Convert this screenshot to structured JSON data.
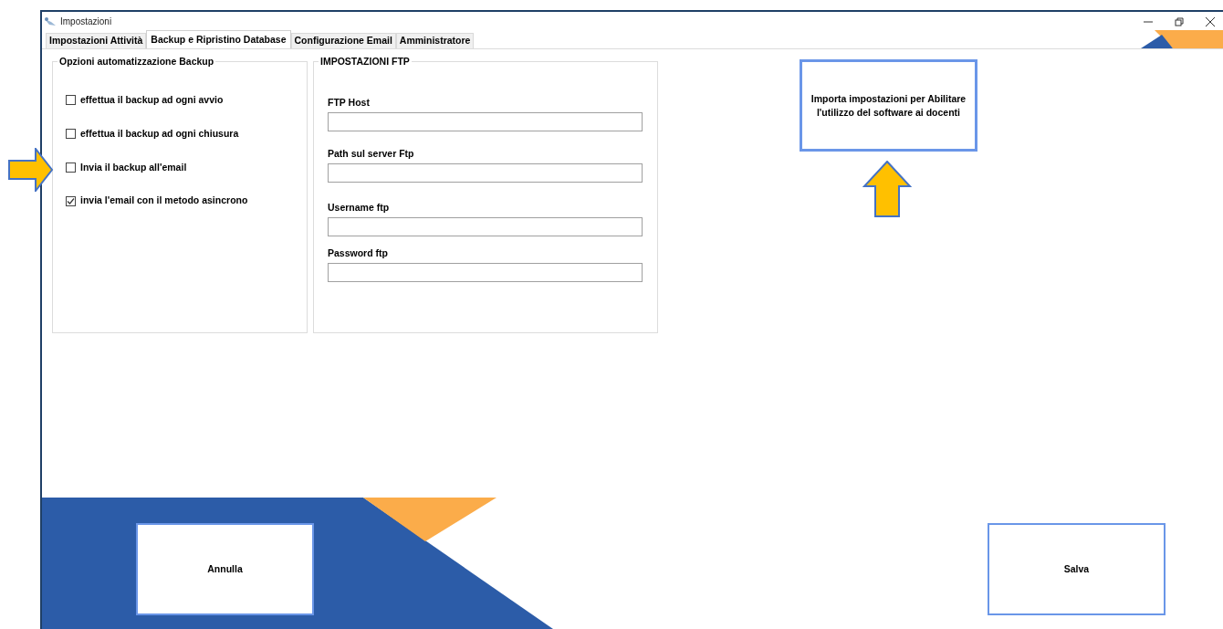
{
  "window": {
    "title": "Impostazioni"
  },
  "tabs": [
    {
      "label": "Impostazioni Attività",
      "selected": false
    },
    {
      "label": "Backup e Ripristino Database",
      "selected": true
    },
    {
      "label": "Configurazione Email",
      "selected": false
    },
    {
      "label": "Amministratore",
      "selected": false
    }
  ],
  "backup_options": {
    "title": "Opzioni automatizzazione Backup",
    "items": [
      {
        "label": "effettua il backup ad ogni avvio",
        "checked": false
      },
      {
        "label": "effettua il backup ad ogni chiusura",
        "checked": false
      },
      {
        "label": "Invia il backup all'email",
        "checked": false
      },
      {
        "label": "invia l'email con il metodo asincrono",
        "checked": true
      }
    ]
  },
  "ftp_settings": {
    "title": "IMPOSTAZIONI FTP",
    "fields": [
      {
        "label": "FTP Host"
      },
      {
        "label": "Path sul server Ftp"
      },
      {
        "label": "Username ftp"
      },
      {
        "label": "Password ftp"
      }
    ]
  },
  "import_button": {
    "label": "Importa impostazioni per Abilitare l'utilizzo del software ai docenti"
  },
  "buttons": [
    {
      "label": "Annulla"
    },
    {
      "label": "Salva"
    }
  ]
}
